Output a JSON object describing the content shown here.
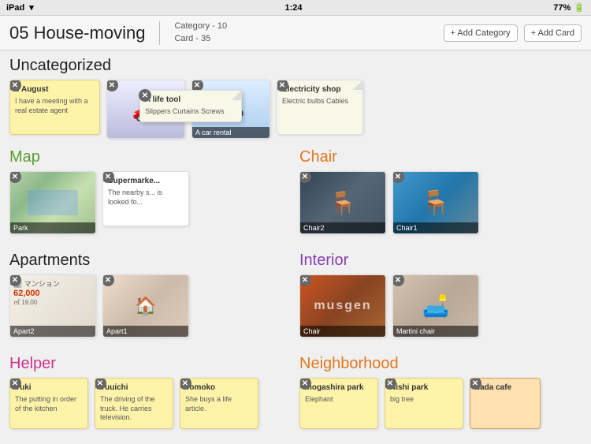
{
  "statusBar": {
    "left": "iPad",
    "time": "1:24",
    "right": "77%"
  },
  "header": {
    "title": "05 House-moving",
    "meta": {
      "category": "Category - 10",
      "card": "Card - 35"
    },
    "addCategory": "+ Add Category",
    "addCard": "+ Add Card"
  },
  "sections": {
    "uncategorized": {
      "title": "Uncategorized",
      "colorClass": "default",
      "cards": [
        {
          "type": "text",
          "title": "8 August",
          "body": "I have a meeting with a real estate agent",
          "tag": "yellow"
        },
        {
          "type": "image",
          "img": "car2",
          "label": ""
        },
        {
          "type": "image",
          "img": "car1",
          "label": "A car rental"
        },
        {
          "type": "text",
          "title": "Electricity shop",
          "body": "Electric bulbs Cables",
          "tag": "notepad"
        }
      ],
      "floating1": {
        "title": "A life tool",
        "body": "Slippers Curtains Screws"
      },
      "floating2": {
        "title": "Supermarke...",
        "body": "The nearby s... is looked fo..."
      }
    },
    "map": {
      "title": "Map",
      "colorClass": "green",
      "cards": [
        {
          "type": "image",
          "img": "map",
          "label": "Park"
        },
        {
          "type": "image",
          "img": "supermarket",
          "label": ""
        }
      ]
    },
    "chair": {
      "title": "Chair",
      "colorClass": "orange",
      "cards": [
        {
          "type": "image",
          "img": "chair2",
          "label": "Chair2"
        },
        {
          "type": "image",
          "img": "chair1",
          "label": "Chair1"
        }
      ]
    },
    "apartments": {
      "title": "Apartments",
      "colorClass": "default",
      "cards": [
        {
          "type": "image",
          "img": "apart2",
          "label": "Apart2"
        },
        {
          "type": "image",
          "img": "apart1",
          "label": "Apart1"
        }
      ]
    },
    "interior": {
      "title": "Interior",
      "colorClass": "purple",
      "cards": [
        {
          "type": "image",
          "img": "interior1",
          "label": "Chair"
        },
        {
          "type": "image",
          "img": "interior2",
          "label": "Martini chair"
        }
      ]
    },
    "helper": {
      "title": "Helper",
      "colorClass": "pink",
      "cards": [
        {
          "type": "text",
          "title": "Yuki",
          "body": "The putting in order of the kitchen",
          "tag": "yellow"
        },
        {
          "type": "text",
          "title": "Yuuichi",
          "body": "The driving of the truck. He carries television.",
          "tag": "yellow"
        },
        {
          "type": "text",
          "title": "Tomoko",
          "body": "She buys a life article.",
          "tag": "yellow"
        }
      ]
    },
    "neighborhood": {
      "title": "Neighborhood",
      "colorClass": "orange",
      "cards": [
        {
          "type": "text",
          "title": "Inogashira park",
          "body": "Elephant",
          "tag": "yellow"
        },
        {
          "type": "text",
          "title": "Nishi park",
          "body": "big tree",
          "tag": "yellow"
        },
        {
          "type": "text",
          "title": "dada cafe",
          "body": "",
          "tag": "orange"
        }
      ]
    }
  }
}
